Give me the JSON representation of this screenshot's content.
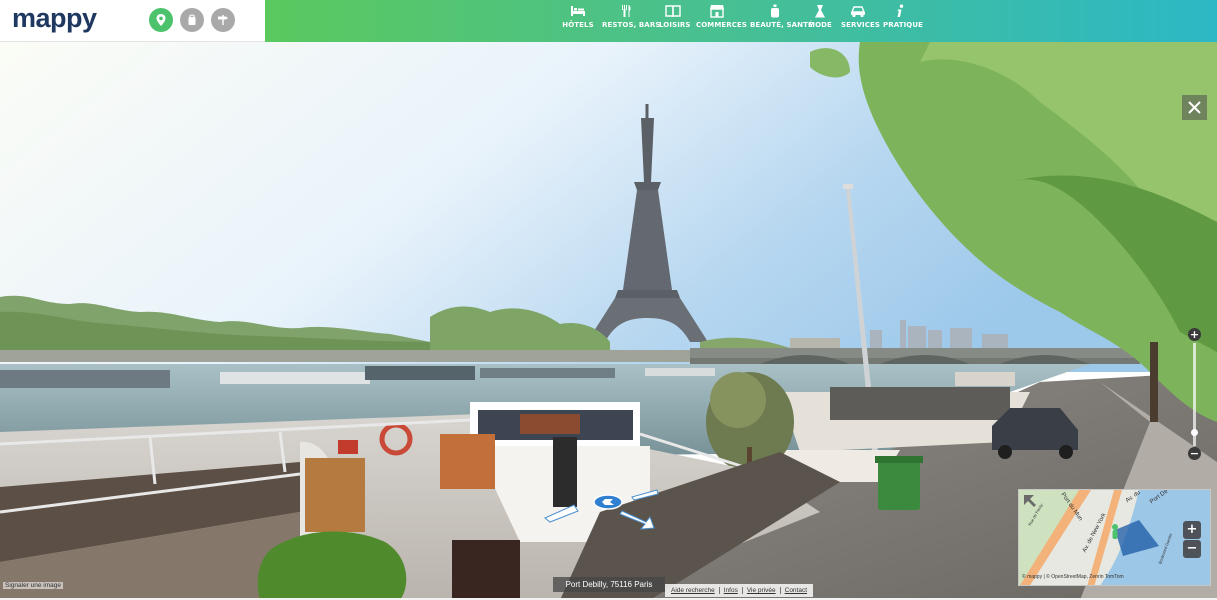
{
  "brand": {
    "logo_text": "mappy"
  },
  "modes": [
    {
      "icon": "map-pin-icon",
      "active": true
    },
    {
      "icon": "bag-icon",
      "active": false
    },
    {
      "icon": "signpost-icon",
      "active": false
    }
  ],
  "categories": [
    {
      "label": "HÔTELS",
      "icon": "bed-icon"
    },
    {
      "label": "RESTOS, BARS",
      "icon": "cutlery-icon"
    },
    {
      "label": "LOISIRS",
      "icon": "book-icon"
    },
    {
      "label": "COMMERCES",
      "icon": "shop-icon"
    },
    {
      "label": "BEAUTÉ, SANTÉ",
      "icon": "perfume-icon"
    },
    {
      "label": "MODE",
      "icon": "dress-icon"
    },
    {
      "label": "SERVICES",
      "icon": "car-icon"
    },
    {
      "label": "PRATIQUE",
      "icon": "info-icon"
    }
  ],
  "viewer": {
    "close_icon": "close-icon",
    "zoom_in_label": "+",
    "zoom_out_label": "−",
    "zoom_level_fraction": 0.1,
    "address": "Port Debilly, 75116 Paris"
  },
  "minimap": {
    "zoom_in_label": "+",
    "zoom_out_label": "−",
    "attribution": "© mappy   |   © OpenStreetMap, Zenrin TomTom",
    "street_1": "Av. de New York",
    "street_2": "Port du Mun",
    "street_3": "Av. du",
    "street_4": "Port De",
    "street_5": "Rue de Passy",
    "street_6": "Boulevard Garnier"
  },
  "footer": {
    "report_link": "Signaler une image",
    "links": [
      "Aide recherche",
      "Infos",
      "Vie privée",
      "Contact"
    ]
  },
  "colors": {
    "accent_green": "#4bc26b",
    "logo_blue": "#1e3860",
    "bar_gradient_start": "#5bc95e",
    "bar_gradient_end": "#2cb8c5"
  }
}
